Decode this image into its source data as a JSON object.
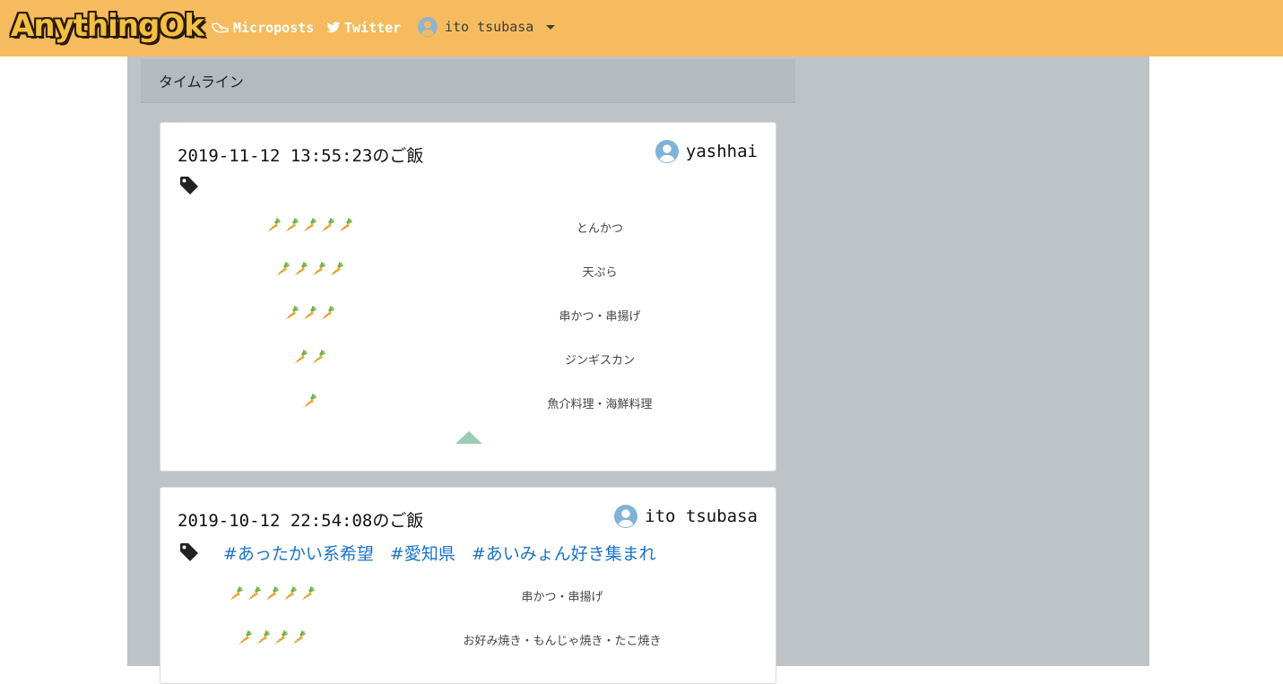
{
  "brand": {
    "logo": "AnythingOk"
  },
  "nav": {
    "microposts": "Microposts",
    "twitter": "Twitter",
    "user": "ito tsubasa"
  },
  "timeline": {
    "header": "タイムライン"
  },
  "posts": [
    {
      "title": "2019-11-12 13:55:23のご飯",
      "user": "yashhai",
      "tags": [],
      "ratings": [
        {
          "stars": 5,
          "dish": "とんかつ"
        },
        {
          "stars": 4,
          "dish": "天ぷら"
        },
        {
          "stars": 3,
          "dish": "串かつ・串揚げ"
        },
        {
          "stars": 2,
          "dish": "ジンギスカン"
        },
        {
          "stars": 1,
          "dish": "魚介料理・海鮮料理"
        }
      ]
    },
    {
      "title": "2019-10-12 22:54:08のご飯",
      "user": "ito tsubasa",
      "tags": [
        "#あったかい系希望",
        "#愛知県",
        "#あいみょん好き集まれ"
      ],
      "ratings": [
        {
          "stars": 5,
          "dish": "串かつ・串揚げ"
        },
        {
          "stars": 4,
          "dish": "お好み焼き・もんじゃ焼き・たこ焼き"
        }
      ]
    }
  ],
  "colors": {
    "navbar": "#f5bb5e",
    "link": "#1a73c9",
    "carrot": "#f0a93a"
  },
  "icons": {
    "rating": "carrot-icon",
    "tag": "tag-icon",
    "user": "user-circle-icon"
  }
}
